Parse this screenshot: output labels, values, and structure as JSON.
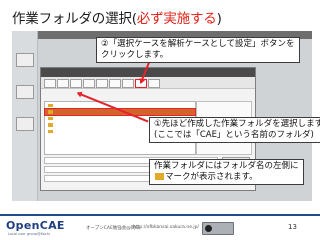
{
  "slide": {
    "title_main": "作業フォルダの選択(",
    "title_emphasis": "必ず実施する",
    "title_end": ")",
    "page_number": "13"
  },
  "callouts": {
    "step2_line1": "②「選択ケースを解析ケースとして設定」ボタンを",
    "step2_line2": "クリックします。",
    "step1_line1": "①先ほど作成した作業フォルダを選択します",
    "step1_line2": "(ここでは「CAE」という名前のフォルダ)",
    "note_line1": "作業フォルダにはフォルダ名の左側に",
    "note_line2": "マークが表示されます。"
  },
  "footer": {
    "logo": "OpenCAE",
    "logo_sub": "Local user group@Kochi",
    "org": "オープンCAE勉強会@岡山",
    "url": "http://ofbkansai.sakura.ne.jp/"
  },
  "colors": {
    "accent_red": "#e2231a",
    "folder_yellow": "#e2a92b",
    "selection_orange": "#d2652a",
    "footer_blue": "#1f4e8c"
  },
  "icons": [
    "folder-icon",
    "cc-license-icon"
  ]
}
